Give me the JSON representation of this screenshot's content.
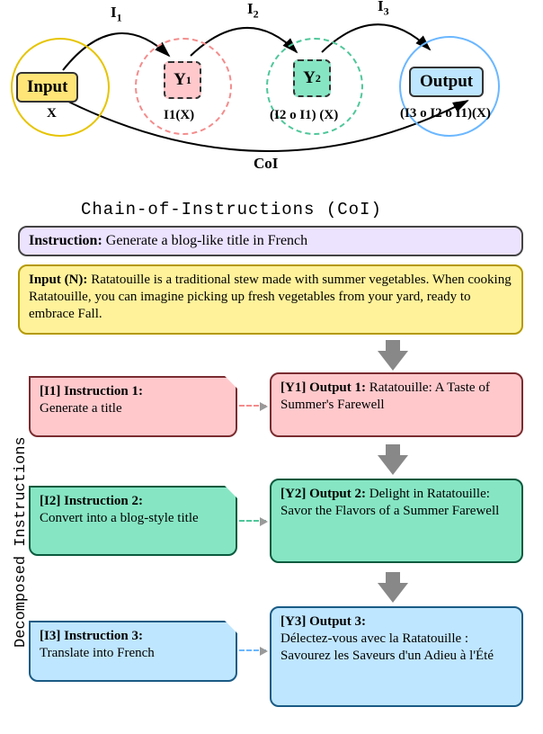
{
  "top": {
    "input_label": "Input",
    "output_label": "Output",
    "y1": "Y",
    "y1_sub": "1",
    "y2": "Y",
    "y2_sub": "2",
    "x_label": "X",
    "i1x": "I1(X)",
    "i2i1x": "(I2 o I1) (X)",
    "i3i2i1x": "(I3 o I2 o I1)(X)",
    "i1": "I",
    "i2": "I",
    "i3": "I",
    "coi_arc": "CoI",
    "caption": "Chain-of-Instructions (CoI)"
  },
  "instruction_header_label": "Instruction:",
  "instruction_header_text": " Generate a blog-like title in French",
  "inputN_label": "Input (N): ",
  "inputN_text": "Ratatouille is a traditional stew made with summer vegetables. When cooking Ratatouille, you can imagine picking up fresh vegetables from your yard, ready to embrace Fall.",
  "steps": [
    {
      "instr_label": "[I1] Instruction 1:",
      "instr_text": "Generate a title",
      "out_label": "[Y1] Output 1: ",
      "out_text": "Ratatouille: A Taste of Summer's Farewell"
    },
    {
      "instr_label": "[I2] Instruction 2:",
      "instr_text": "Convert into a blog-style title",
      "out_label": "[Y2] Output 2: ",
      "out_text": "Delight in Ratatouille: Savor the Flavors of a Summer Farewell"
    },
    {
      "instr_label": "[I3] Instruction 3:",
      "instr_text": "Translate into French",
      "out_label": "[Y3] Output 3:",
      "out_text": "Délectez-vous avec la Ratatouille : Savourez les Saveurs d'un Adieu à l'Été"
    }
  ],
  "side_label": "Decomposed Instructions",
  "chart_data": {
    "type": "diagram",
    "nodes": [
      {
        "id": "X",
        "label": "Input",
        "kind": "input"
      },
      {
        "id": "Y1",
        "label": "Y1 = I1(X)",
        "kind": "intermediate"
      },
      {
        "id": "Y2",
        "label": "Y2 = (I2 o I1)(X)",
        "kind": "intermediate"
      },
      {
        "id": "Output",
        "label": "Output = (I3 o I2 o I1)(X)",
        "kind": "output"
      }
    ],
    "edges": [
      {
        "from": "X",
        "to": "Y1",
        "label": "I1"
      },
      {
        "from": "Y1",
        "to": "Y2",
        "label": "I2"
      },
      {
        "from": "Y2",
        "to": "Output",
        "label": "I3"
      },
      {
        "from": "X",
        "to": "Output",
        "label": "CoI"
      }
    ],
    "decomposition_example": {
      "overall_instruction": "Generate a blog-like title in French",
      "input": "Ratatouille is a traditional stew made with summer vegetables. When cooking Ratatouille, you can imagine picking up fresh vegetables from your yard, ready to embrace Fall.",
      "steps": [
        {
          "instruction": "Generate a title",
          "output": "Ratatouille: A Taste of Summer's Farewell"
        },
        {
          "instruction": "Convert into a blog-style title",
          "output": "Delight in Ratatouille: Savor the Flavors of a Summer Farewell"
        },
        {
          "instruction": "Translate into French",
          "output": "Délectez-vous avec la Ratatouille : Savourez les Saveurs d'un Adieu à l'Été"
        }
      ]
    }
  }
}
